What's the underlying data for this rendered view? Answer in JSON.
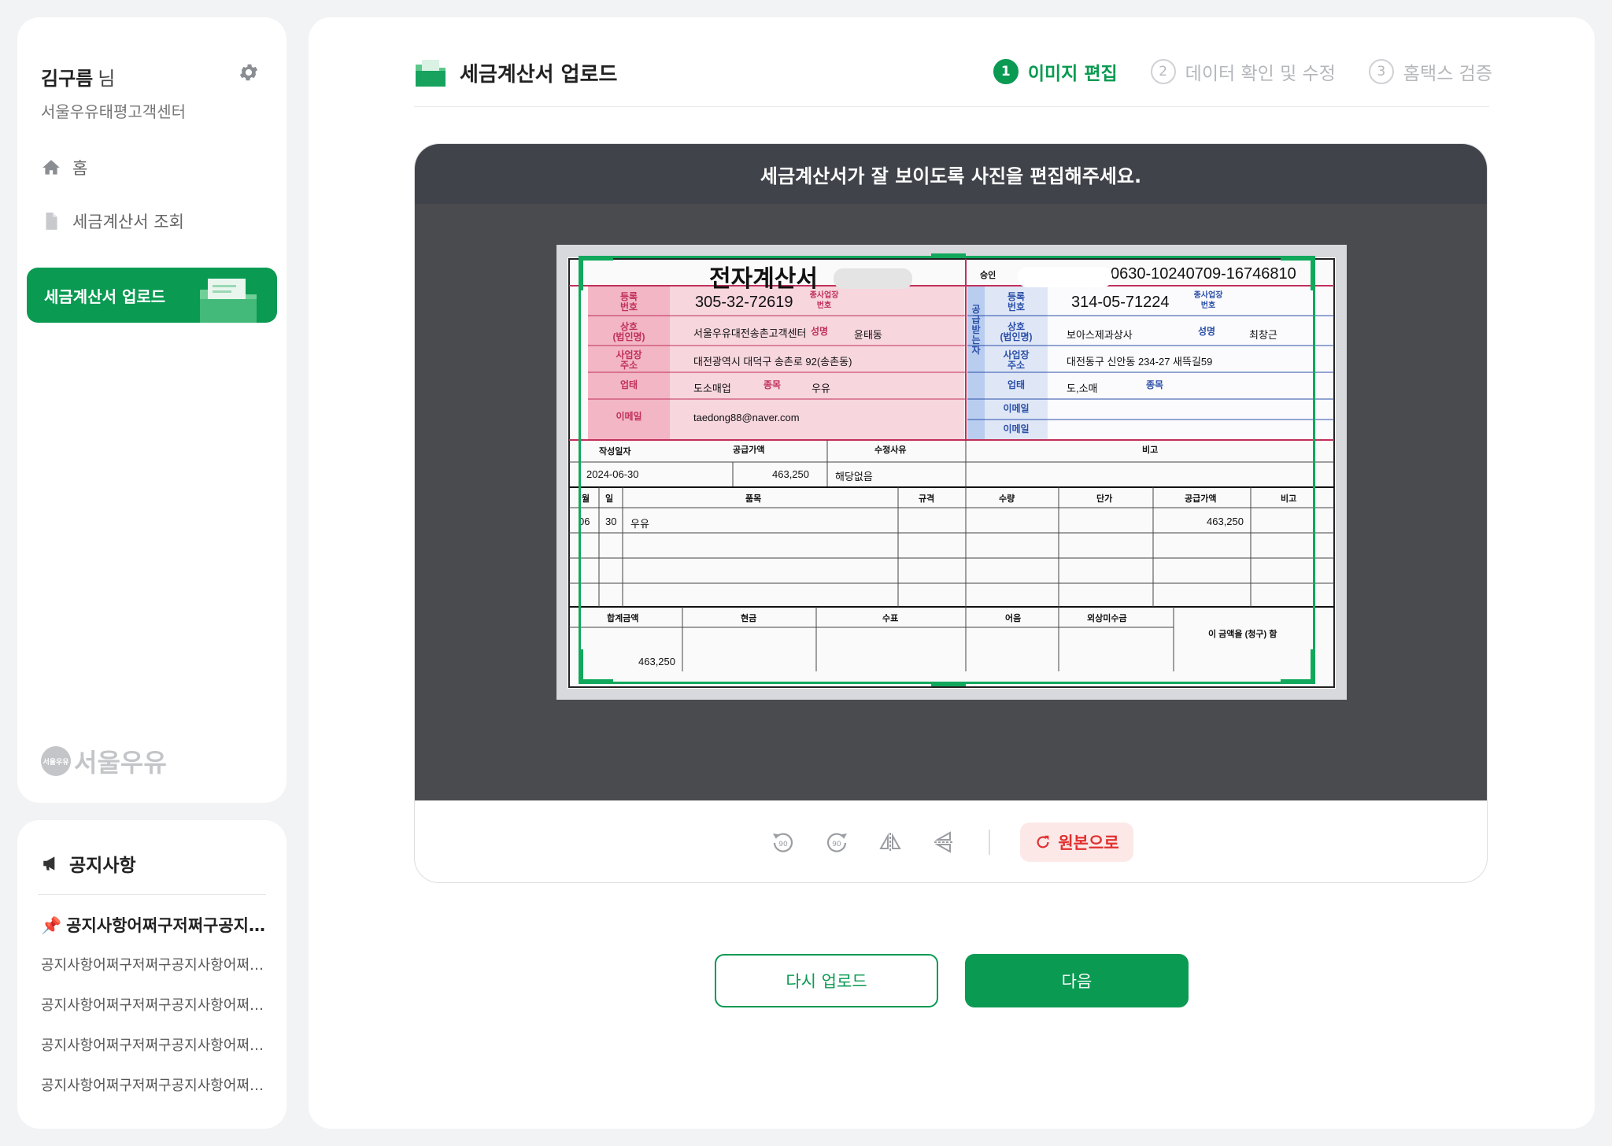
{
  "user": {
    "name": "김구름",
    "suffix": "님",
    "company": "서울우유태평고객센터"
  },
  "nav": {
    "home": "홈",
    "view_invoices": "세금계산서 조회",
    "upload": "세금계산서 업로드"
  },
  "brand": {
    "logo_badge": "서울우유",
    "logo_text": "서울우유"
  },
  "notice": {
    "title": "공지사항",
    "pinned": "공지사항어쩌구저쩌구공지사항어쩌구저쩌구",
    "items": [
      "공지사항어쩌구저쩌구공지사항어쩌구저쩌구",
      "공지사항어쩌구저쩌구공지사항어쩌구저쩌구",
      "공지사항어쩌구저쩌구공지사항어쩌구저쩌구",
      "공지사항어쩌구저쩌구공지사항어쩌구저쩌구"
    ]
  },
  "page": {
    "title": "세금계산서 업로드"
  },
  "steps": [
    {
      "num": "1",
      "label": "이미지 편집",
      "active": true
    },
    {
      "num": "2",
      "label": "데이터 확인 및 수정",
      "active": false
    },
    {
      "num": "3",
      "label": "홈택스 검증",
      "active": false
    }
  ],
  "editor": {
    "instruction": "세금계산서가 잘 보이도록 사진을 편집해주세요."
  },
  "toolbar": {
    "rotate_left_label": "90",
    "rotate_right_label": "90",
    "reset_label": "원본으로"
  },
  "buttons": {
    "reupload": "다시 업로드",
    "next": "다음"
  },
  "invoice": {
    "title": "전자계산서",
    "approval_label": "승인",
    "approval_no": "0630-10240709-16746810",
    "supplier": {
      "reg_label": "등록\n번호",
      "reg_no": "305-32-72619",
      "branch_label": "종사업장\n번호",
      "name_label": "상호\n(법인명)",
      "name": "서울우유대전송촌고객센터",
      "ceo_label": "성명",
      "ceo": "윤태동",
      "addr_label": "사업장\n주소",
      "addr": "대전광역시 대덕구 송촌로 92(송촌동)",
      "type_label": "업태",
      "type": "도소매업",
      "item_label": "종목",
      "item": "우유",
      "email_label": "이메일",
      "email": "taedong88@naver.com"
    },
    "buyer": {
      "side_label": "공급받는자",
      "reg_label": "등록\n번호",
      "reg_no": "314-05-71224",
      "branch_label": "종사업장\n번호",
      "name_label": "상호\n(법인명)",
      "name": "보아스제과상사",
      "ceo_label": "성명",
      "ceo": "최창근",
      "addr_label": "사업장\n주소",
      "addr": "대전동구 신안동 234-27 새뜩길59",
      "type_label": "업태",
      "type": "도,소매",
      "item_label": "종목",
      "email_label": "이메일",
      "email2_label": "이메일"
    },
    "summary": {
      "date_label": "작성일자",
      "supply_label": "공급가액",
      "reason_label": "수정사유",
      "note_label": "비고",
      "date": "2024-06-30",
      "supply": "463,250",
      "reason": "해당없음"
    },
    "items_header": [
      "월",
      "일",
      "품목",
      "규격",
      "수량",
      "단가",
      "공급가액",
      "비고"
    ],
    "items": [
      {
        "month": "06",
        "day": "30",
        "name": "우유",
        "amount": "463,250"
      }
    ],
    "totals": {
      "total_label": "합계금액",
      "cash_label": "현금",
      "check_label": "수표",
      "note_label": "어음",
      "credit_label": "외상미수금",
      "claim": "이 금액을 (청구) 함",
      "total": "463,250"
    }
  }
}
